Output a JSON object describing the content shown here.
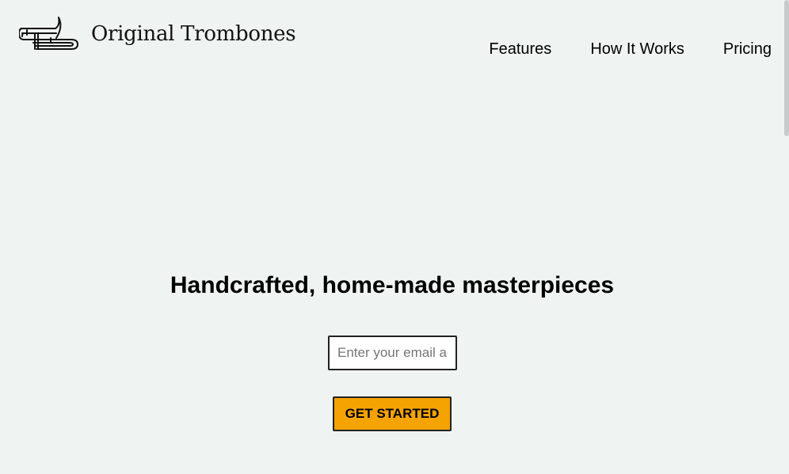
{
  "brand": {
    "name": "Original Trombones",
    "logo_icon": "trombone-icon"
  },
  "nav": {
    "items": [
      {
        "label": "Features"
      },
      {
        "label": "How It Works"
      },
      {
        "label": "Pricing"
      }
    ]
  },
  "hero": {
    "headline": "Handcrafted, home-made masterpieces",
    "email_placeholder": "Enter your email address",
    "email_value": "",
    "cta_label": "GET STARTED"
  },
  "colors": {
    "background": "#eff3f2",
    "cta": "#f5a300",
    "border": "#222222"
  }
}
